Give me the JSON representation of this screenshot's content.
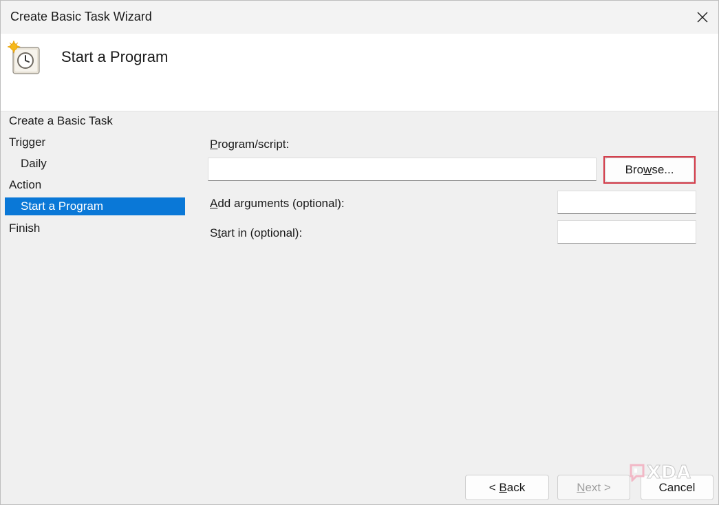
{
  "window": {
    "title": "Create Basic Task Wizard"
  },
  "header": {
    "title": "Start a Program",
    "icon": "task-scheduler-clock-icon"
  },
  "nav": {
    "items": [
      {
        "label": "Create a Basic Task"
      },
      {
        "label": "Trigger"
      },
      {
        "label": "Daily"
      },
      {
        "label": "Action"
      },
      {
        "label": "Start a Program"
      },
      {
        "label": "Finish"
      }
    ]
  },
  "form": {
    "program_label_accel": "P",
    "program_label_rest": "rogram/script:",
    "program_value": "",
    "browse_pre": "Bro",
    "browse_accel": "w",
    "browse_post": "se...",
    "arguments_label_accel": "A",
    "arguments_label_rest": "dd arguments (optional):",
    "arguments_value": "",
    "start_in_label_pre": "S",
    "start_in_label_accel": "t",
    "start_in_label_rest": "art in (optional):",
    "start_in_value": ""
  },
  "buttons": {
    "back_pre": "< ",
    "back_accel": "B",
    "back_post": "ack",
    "next_accel": "N",
    "next_post": "ext >",
    "cancel": "Cancel"
  },
  "watermark": {
    "text": "XDA"
  },
  "colors": {
    "selection": "#0a78d7",
    "highlight": "#d33a48"
  }
}
